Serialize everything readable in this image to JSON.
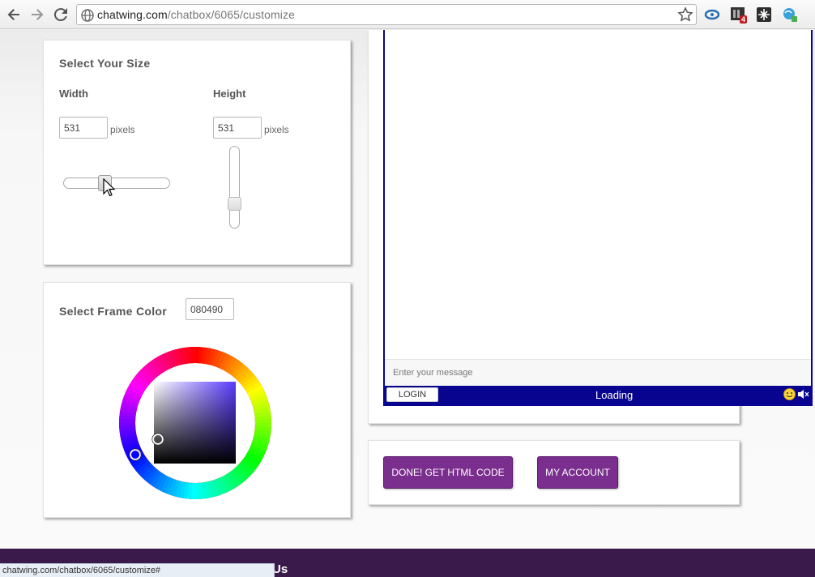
{
  "browser": {
    "url_domain": "chatwing.com",
    "url_path": "/chatbox/6065/customize",
    "extension_badge": "4"
  },
  "size_panel": {
    "title": "Select Your Size",
    "width_label": "Width",
    "height_label": "Height",
    "width_value": "531",
    "height_value": "531",
    "unit": "pixels",
    "width_slider_fraction": 0.39,
    "height_slider_fraction": 0.62
  },
  "color_panel": {
    "title": "Select Frame Color",
    "color_value": "080490"
  },
  "chat": {
    "message_placeholder": "Enter your message",
    "login_label": "LOGIN",
    "status_text": "Loading",
    "frame_color": "#080490"
  },
  "buttons": {
    "done_label": "DONE! GET HTML CODE",
    "account_label": "MY ACCOUNT",
    "color": "#7a2e8e"
  },
  "footer": {
    "partial_text": "Us"
  },
  "status_bar": {
    "text": "chatwing.com/chatbox/6065/customize#"
  },
  "icons": [
    "back-icon",
    "forward-icon",
    "reload-icon",
    "globe-icon",
    "star-icon",
    "extension-icon",
    "smiley-icon",
    "speaker-mute-icon",
    "cursor-icon"
  ]
}
